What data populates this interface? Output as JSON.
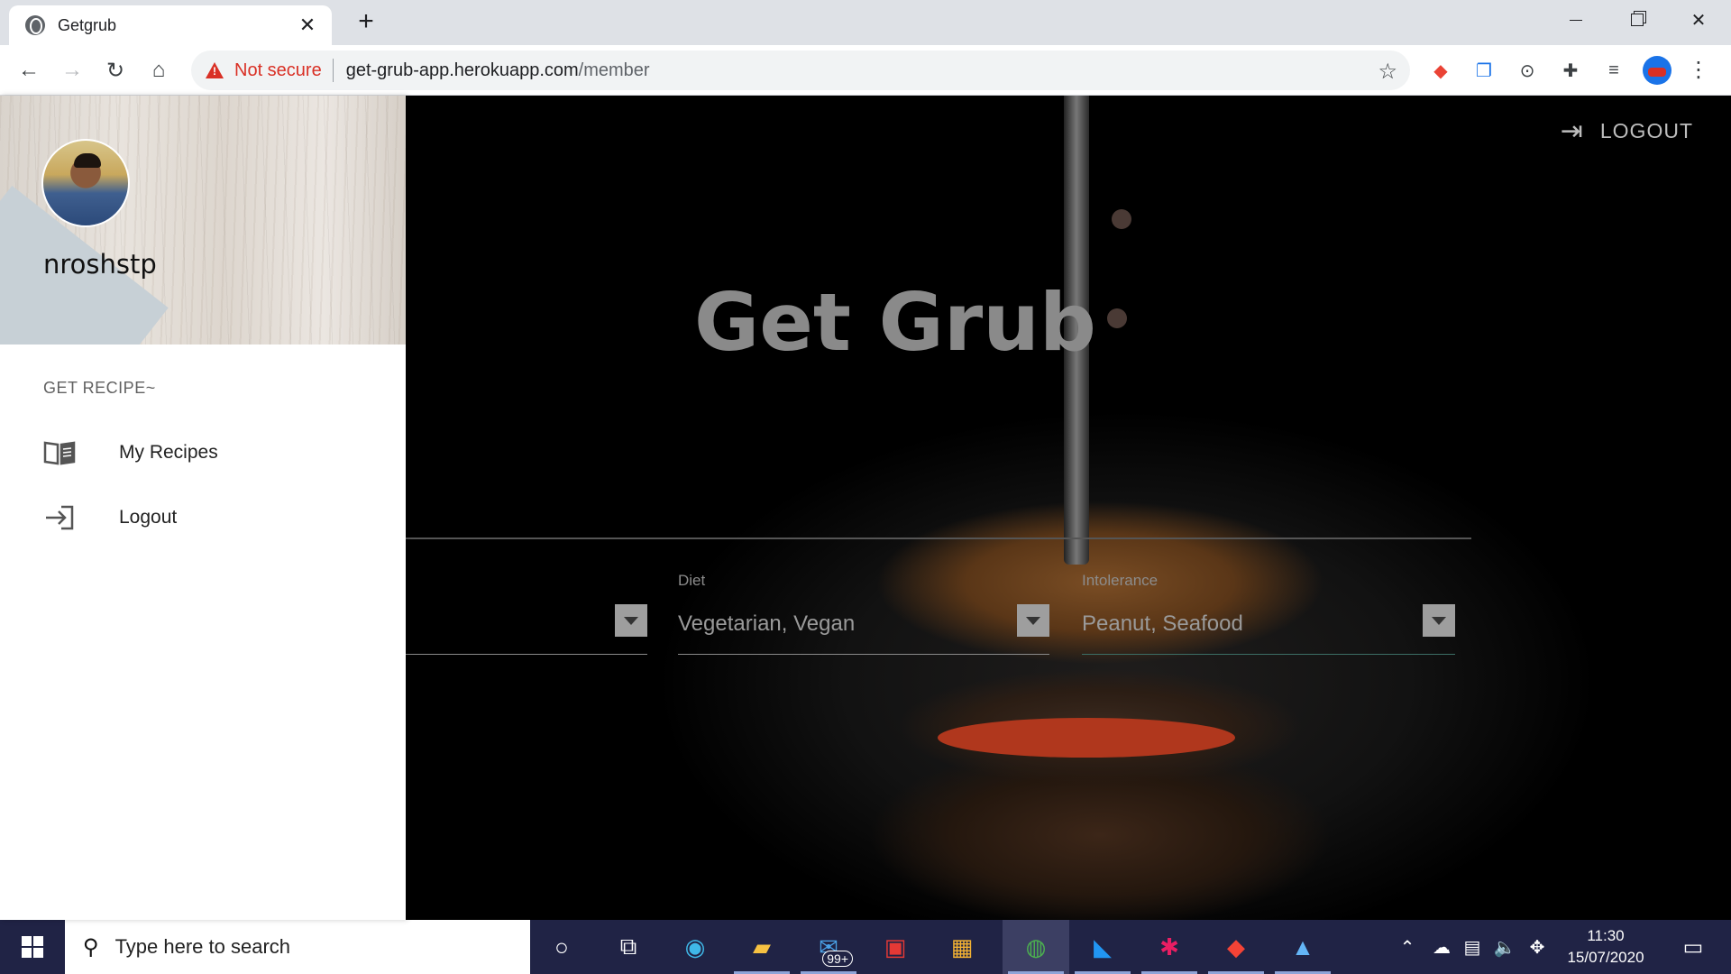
{
  "browser": {
    "tab_title": "Getgrub",
    "tab_close": "✕",
    "new_tab": "+",
    "security_label": "Not secure",
    "url_host": "get-grub-app.herokuapp.com",
    "url_path": "/member",
    "nav": {
      "back": "←",
      "forward": "→",
      "reload": "↻",
      "home": "⌂"
    },
    "star": "☆",
    "menu": "⋮"
  },
  "sidebar": {
    "username": "nroshstp",
    "section_label": "GET RECIPE~",
    "items": [
      {
        "label": "My Recipes",
        "icon": "book-open-icon",
        "glyph": "📖"
      },
      {
        "label": "Logout",
        "icon": "login-arrow-icon",
        "glyph": "⇥"
      }
    ]
  },
  "hero": {
    "title": "Get Grub",
    "logout_label": "LOGOUT",
    "logout_glyph": "⇥"
  },
  "filters": [
    {
      "label": "",
      "value": ""
    },
    {
      "label": "Diet",
      "value": "Vegetarian, Vegan"
    },
    {
      "label": "Intolerance",
      "value": "Peanut, Seafood"
    }
  ],
  "taskbar": {
    "search_placeholder": "Type here to search",
    "mail_badge": "99+",
    "time": "11:30",
    "date": "15/07/2020"
  },
  "colors": {
    "accent_underline": "#3c6e65",
    "taskbar_bg": "#202345",
    "warning_red": "#d93025"
  }
}
